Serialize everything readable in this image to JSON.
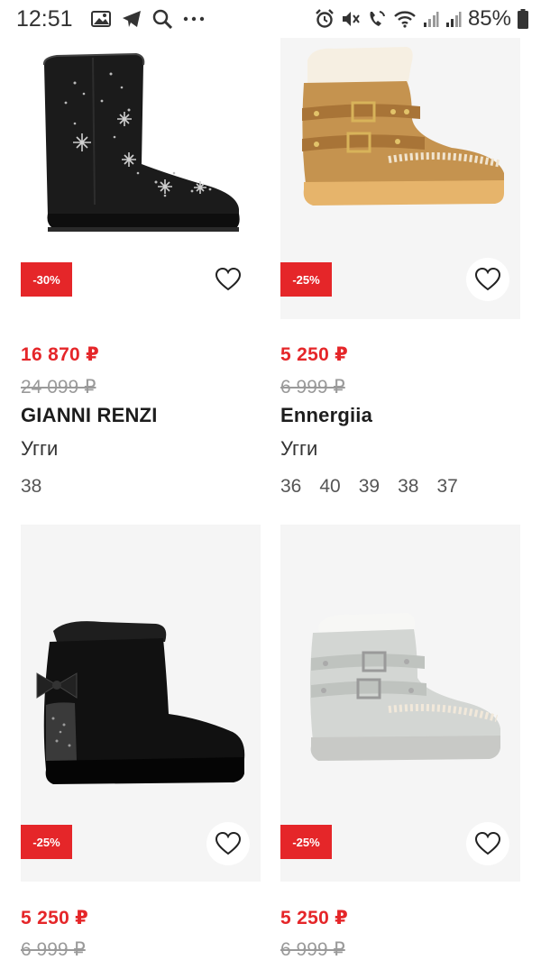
{
  "status_bar": {
    "time": "12:51",
    "battery": "85%",
    "left_icons": [
      "image-icon",
      "telegram-icon",
      "search-icon",
      "more-icon"
    ],
    "right_icons": [
      "alarm-icon",
      "mute-icon",
      "volte-icon",
      "wifi-icon",
      "signal-icon",
      "signal-icon",
      "battery-icon"
    ]
  },
  "products": [
    {
      "discount": "-30%",
      "price": "16 870 ₽",
      "old_price": "24 099 ₽",
      "brand": "GIANNI RENZI",
      "category": "Угги",
      "sizes": [
        "38"
      ],
      "image": "black-studded-ugg-boot"
    },
    {
      "discount": "-25%",
      "price": "5 250 ₽",
      "old_price": "6 999 ₽",
      "brand": "Ennergiia",
      "category": "Угги",
      "sizes": [
        "36",
        "40",
        "39",
        "38",
        "37"
      ],
      "image": "tan-buckled-ugg-boot"
    },
    {
      "discount": "-25%",
      "price": "5 250 ₽",
      "old_price": "6 999 ₽",
      "image": "black-bow-ugg-boot"
    },
    {
      "discount": "-25%",
      "price": "5 250 ₽",
      "old_price": "6 999 ₽",
      "image": "grey-buckled-ugg-boot"
    }
  ],
  "colors": {
    "accent": "#e52629",
    "old_price": "#9a9a9a",
    "image_bg": "#f5f5f5"
  }
}
